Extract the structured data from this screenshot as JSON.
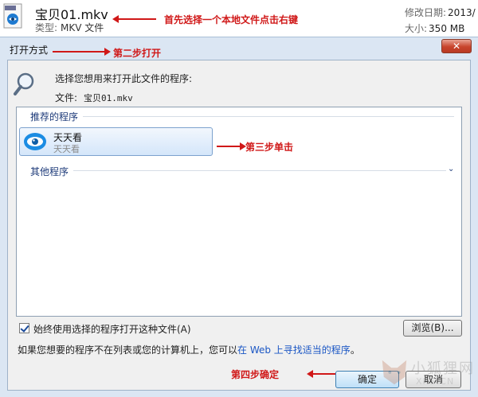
{
  "file_info": {
    "name": "宝贝01.mkv",
    "type_label": "类型:",
    "type_value": "MKV 文件",
    "date_label": "修改日期:",
    "date_value": "2013/",
    "size_label": "大小:",
    "size_value": "350 MB",
    "icon": "mkv-file-icon"
  },
  "annotations": {
    "step1": "首先选择一个本地文件点击右键",
    "step2": "第二步打开",
    "step3": "第三步单击",
    "step4": "第四步确定"
  },
  "dialog": {
    "title": "打开方式",
    "close_label": "✕",
    "prompt": "选择您想用来打开此文件的程序:",
    "file_label": "文件:",
    "file_value": "宝贝01.mkv",
    "recommended_header": "推荐的程序",
    "recommended_programs": [
      {
        "name": "天天看",
        "publisher": "天天看",
        "icon": "tiantiankan-app-icon"
      }
    ],
    "other_header": "其他程序",
    "always_use_label": "始终使用选择的程序打开这种文件(A)",
    "always_use_checked": true,
    "browse_label": "浏览(B)...",
    "bottom_text": "如果您想要的程序不在列表或您的计算机上，您可以",
    "bottom_link": "在 Web 上寻找适当的程序",
    "bottom_end": "。",
    "ok_label": "确定",
    "cancel_label": "取消"
  },
  "watermark": {
    "text": "小狐狸网",
    "sub": "XHS.CN"
  },
  "colors": {
    "annotation": "#d01818",
    "link": "#1a56c4",
    "group_header": "#1e3b7a"
  }
}
